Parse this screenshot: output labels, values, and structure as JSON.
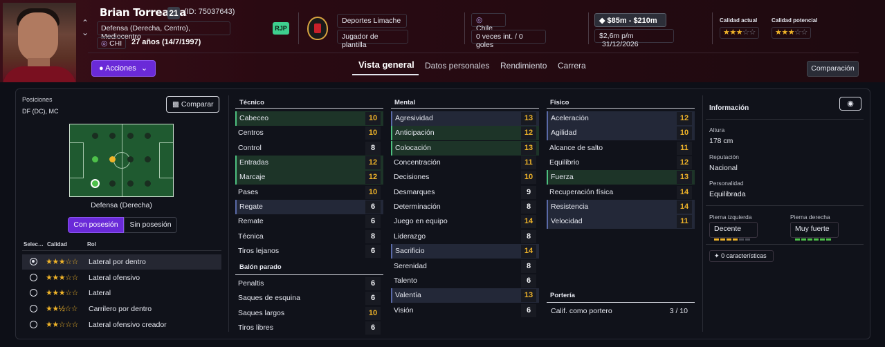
{
  "header": {
    "name": "Brian Torrealba",
    "number": "21",
    "id_text": "(ID: 75037643)",
    "positions": "Defensa (Derecha, Centro), Mediocentro",
    "nationality_code": "CHI",
    "age_text": "27 años (14/7/1997)",
    "actions_label": "Acciones",
    "badge": "RJP",
    "club": "Deportes Limache",
    "squad_status": "Jugador de plantilla",
    "nation": "Chile",
    "caps": "0 veces int. / 0 goles",
    "value": "$85m - $210m",
    "wage": "$2,6m p/m",
    "contract_end": "31/12/2026",
    "current_ability_label": "Calidad actual",
    "current_ability_stars": 3,
    "potential_ability_label": "Calidad potencial",
    "potential_ability_stars": 3,
    "compare_top_label": "Comparación"
  },
  "tabs": [
    "Vista general",
    "Datos personales",
    "Rendimiento",
    "Carrera"
  ],
  "left": {
    "positions_label": "Posiciones",
    "positions_value": "DF (DC), MC",
    "compare_label": "Comparar",
    "pitch_caption": "Defensa (Derecha)",
    "toggle_on": "Con posesión",
    "toggle_off": "Sin posesión",
    "role_headers": [
      "Selec…",
      "Calidad",
      "Rol"
    ],
    "roles": [
      {
        "name": "Lateral por dentro",
        "stars": "★★★☆☆",
        "selected": true
      },
      {
        "name": "Lateral ofensivo",
        "stars": "★★★☆☆",
        "selected": false
      },
      {
        "name": "Lateral",
        "stars": "★★★☆☆",
        "selected": false
      },
      {
        "name": "Carrilero por dentro",
        "stars": "★★½☆☆",
        "selected": false
      },
      {
        "name": "Lateral ofensivo creador",
        "stars": "★★☆☆☆",
        "selected": false
      }
    ]
  },
  "technical_title": "Técnico",
  "technical": [
    {
      "name": "Cabeceo",
      "value": "10",
      "hl": "g",
      "color": "y"
    },
    {
      "name": "Centros",
      "value": "10",
      "hl": "",
      "color": "y"
    },
    {
      "name": "Control",
      "value": "8",
      "hl": "",
      "color": "w"
    },
    {
      "name": "Entradas",
      "value": "12",
      "hl": "g",
      "color": "y"
    },
    {
      "name": "Marcaje",
      "value": "12",
      "hl": "g",
      "color": "y"
    },
    {
      "name": "Pases",
      "value": "10",
      "hl": "",
      "color": "y"
    },
    {
      "name": "Regate",
      "value": "6",
      "hl": "b",
      "color": "w"
    },
    {
      "name": "Remate",
      "value": "6",
      "hl": "",
      "color": "w"
    },
    {
      "name": "Técnica",
      "value": "8",
      "hl": "",
      "color": "w"
    },
    {
      "name": "Tiros lejanos",
      "value": "6",
      "hl": "",
      "color": "w"
    }
  ],
  "set_pieces_title": "Balón parado",
  "set_pieces": [
    {
      "name": "Penaltis",
      "value": "6",
      "hl": "",
      "color": "w"
    },
    {
      "name": "Saques de esquina",
      "value": "6",
      "hl": "",
      "color": "w"
    },
    {
      "name": "Saques largos",
      "value": "10",
      "hl": "",
      "color": "y"
    },
    {
      "name": "Tiros libres",
      "value": "6",
      "hl": "",
      "color": "w"
    }
  ],
  "mental_title": "Mental",
  "mental": [
    {
      "name": "Agresividad",
      "value": "13",
      "hl": "b",
      "color": "y"
    },
    {
      "name": "Anticipación",
      "value": "12",
      "hl": "g",
      "color": "y"
    },
    {
      "name": "Colocación",
      "value": "13",
      "hl": "g",
      "color": "y"
    },
    {
      "name": "Concentración",
      "value": "11",
      "hl": "",
      "color": "y"
    },
    {
      "name": "Decisiones",
      "value": "10",
      "hl": "",
      "color": "y"
    },
    {
      "name": "Desmarques",
      "value": "9",
      "hl": "",
      "color": "w"
    },
    {
      "name": "Determinación",
      "value": "8",
      "hl": "",
      "color": "w"
    },
    {
      "name": "Juego en equipo",
      "value": "14",
      "hl": "",
      "color": "y"
    },
    {
      "name": "Liderazgo",
      "value": "8",
      "hl": "",
      "color": "w"
    },
    {
      "name": "Sacrificio",
      "value": "14",
      "hl": "b",
      "color": "y"
    },
    {
      "name": "Serenidad",
      "value": "8",
      "hl": "",
      "color": "w"
    },
    {
      "name": "Talento",
      "value": "6",
      "hl": "",
      "color": "w"
    },
    {
      "name": "Valentía",
      "value": "13",
      "hl": "b",
      "color": "y"
    },
    {
      "name": "Visión",
      "value": "6",
      "hl": "",
      "color": "w"
    }
  ],
  "physical_title": "Físico",
  "physical": [
    {
      "name": "Aceleración",
      "value": "12",
      "hl": "b",
      "color": "y"
    },
    {
      "name": "Agilidad",
      "value": "10",
      "hl": "b",
      "color": "y"
    },
    {
      "name": "Alcance de salto",
      "value": "11",
      "hl": "",
      "color": "y"
    },
    {
      "name": "Equilibrio",
      "value": "12",
      "hl": "",
      "color": "y"
    },
    {
      "name": "Fuerza",
      "value": "13",
      "hl": "g",
      "color": "y"
    },
    {
      "name": "Recuperación física",
      "value": "14",
      "hl": "",
      "color": "y"
    },
    {
      "name": "Resistencia",
      "value": "14",
      "hl": "b",
      "color": "y"
    },
    {
      "name": "Velocidad",
      "value": "11",
      "hl": "b",
      "color": "y"
    }
  ],
  "goalkeeping_title": "Portería",
  "goalkeeping": {
    "name": "Calif. como portero",
    "value": "3 / 10"
  },
  "info": {
    "title": "Información",
    "height_label": "Altura",
    "height": "178 cm",
    "reputation_label": "Reputación",
    "reputation": "Nacional",
    "personality_label": "Personalidad",
    "personality": "Equilibrada",
    "left_foot_label": "Pierna izquierda",
    "left_foot": "Decente",
    "left_foot_level": 0.6,
    "right_foot_label": "Pierna derecha",
    "right_foot": "Muy fuerte",
    "right_foot_level": 1.0,
    "traits": "0 características"
  }
}
